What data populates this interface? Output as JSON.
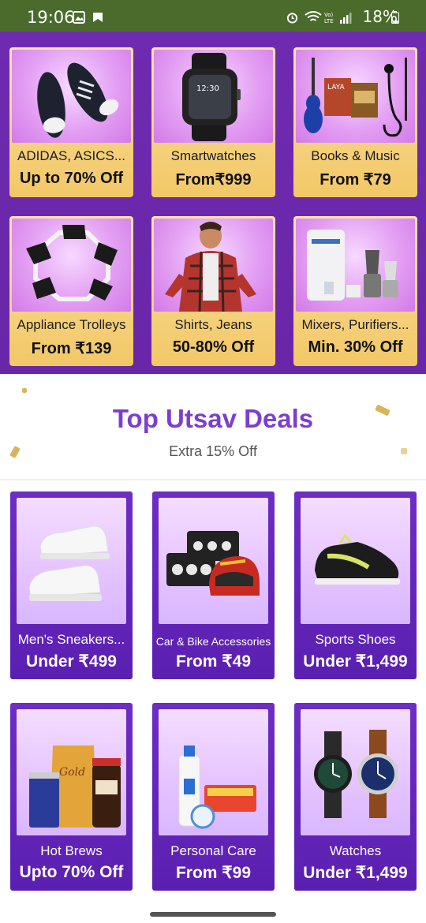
{
  "status_bar": {
    "time": "19:06",
    "battery": "18%",
    "icons": [
      "gallery-icon",
      "notification-icon",
      "alarm-icon",
      "wifi-icon",
      "volte-icon",
      "signal-icon",
      "battery-icon"
    ]
  },
  "top_grid": [
    {
      "name": "ADIDAS, ASICS...",
      "offer": "Up to 70% Off",
      "icon": "shoes-icon"
    },
    {
      "name": "Smartwatches",
      "offer": "From₹999",
      "icon": "smartwatch-icon"
    },
    {
      "name": "Books & Music",
      "offer": "From ₹79",
      "icon": "books-music-icon"
    },
    {
      "name": "Appliance Trolleys",
      "offer": "From ₹139",
      "icon": "trolley-icon"
    },
    {
      "name": "Shirts, Jeans",
      "offer": "50-80% Off",
      "icon": "shirt-model-icon"
    },
    {
      "name": "Mixers, Purifiers...",
      "offer": "Min. 30% Off",
      "icon": "mixer-purifier-icon"
    }
  ],
  "deals_section": {
    "title": "Top Utsav Deals",
    "subtitle": "Extra 15% Off"
  },
  "utsav_grid": [
    {
      "name": "Men's Sneakers...",
      "offer": "Under ₹499",
      "icon": "sneakers-icon"
    },
    {
      "name": "Car & Bike Accessories",
      "offer": "From ₹49",
      "icon": "helmet-lights-icon"
    },
    {
      "name": "Sports Shoes",
      "offer": "Under ₹1,499",
      "icon": "sports-shoe-icon"
    },
    {
      "name": "Hot Brews",
      "offer": "Upto 70% Off",
      "icon": "coffee-jars-icon"
    },
    {
      "name": "Personal Care",
      "offer": "From ₹99",
      "icon": "personal-care-icon"
    },
    {
      "name": "Watches",
      "offer": "Under ₹1,499",
      "icon": "watches-icon"
    }
  ],
  "colors": {
    "purple_bg": "#6f2bb0",
    "title_purple": "#7b3fd0",
    "gold": "#f2c766",
    "status_green": "#4a6b2c"
  }
}
